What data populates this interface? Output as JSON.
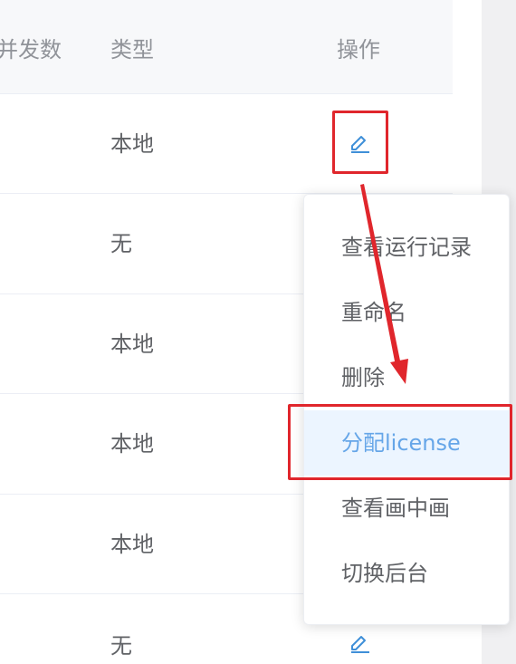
{
  "table": {
    "headers": {
      "concurrency": "并发数",
      "type": "类型",
      "actions": "操作"
    },
    "rows": [
      {
        "type": "本地"
      },
      {
        "type": "无"
      },
      {
        "type": "本地"
      },
      {
        "type": "本地"
      },
      {
        "type": "本地"
      },
      {
        "type": "无"
      }
    ]
  },
  "dropdown": {
    "items": [
      "查看运行记录",
      "重命名",
      "删除",
      "分配license",
      "查看画中画",
      "切换后台"
    ],
    "active_item": "分配license"
  },
  "icons": {
    "edit": "edit-pen-icon"
  },
  "colors": {
    "accent": "#3f8fd8",
    "annotation_red": "#e0262c",
    "active_bg": "#ecf5ff",
    "active_text": "#66a6e8"
  }
}
